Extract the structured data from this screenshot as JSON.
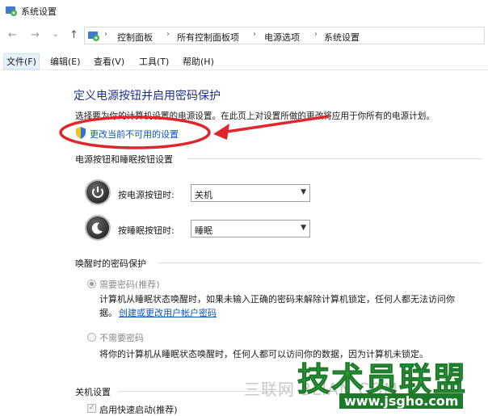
{
  "window": {
    "title": "系统设置"
  },
  "nav": {
    "back": "←",
    "forward": "→",
    "recent": "⌄",
    "up": "↑"
  },
  "address": {
    "crumbs": [
      "控制面板",
      "所有控制面板项",
      "电源选项",
      "系统设置"
    ],
    "separator": "›"
  },
  "menubar": {
    "items": [
      "文件(F)",
      "编辑(E)",
      "查看(V)",
      "工具(T)",
      "帮助(H)"
    ]
  },
  "main": {
    "heading": "定义电源按钮并启用密码保护",
    "intro": "选择要为你的计算机设置的电源设置。在此页上对设置所做的更改将应用于你所有的电源计划。",
    "change_link": "更改当前不可用的设置",
    "power_section": {
      "title": "电源按钮和睡眠按钮设置",
      "power_label": "按电源按钮时:",
      "power_value": "关机",
      "sleep_label": "按睡眠按钮时:",
      "sleep_value": "睡眠"
    },
    "wake_section": {
      "title": "唤醒时的密码保护",
      "require_label": "需要密码(推荐)",
      "require_desc_1": "计算机从睡眠状态唤醒时，如果未输入正确的密码来解除计算机锁定，任何人都无法访问你",
      "require_desc_2_prefix": "据。",
      "require_link": "创建或更改用户帐户密码",
      "norequire_label": "不需要密码",
      "norequire_desc": "将你的计算机从睡眠状态唤醒时，任何人都可以访问你的数据，因为计算机未锁定。"
    },
    "shutdown_section": {
      "title": "关机设置",
      "fast_startup_label": "启用快速启动(推荐)"
    }
  },
  "watermark": {
    "brand": "技术员联盟",
    "site": "www.jsgho.com",
    "faint": "三联网 3LIAN.COM"
  },
  "colors": {
    "heading": "#1e3287",
    "link": "#0b57b8",
    "annotation": "#e0252c",
    "watermark_green": "#2eaa3c"
  }
}
